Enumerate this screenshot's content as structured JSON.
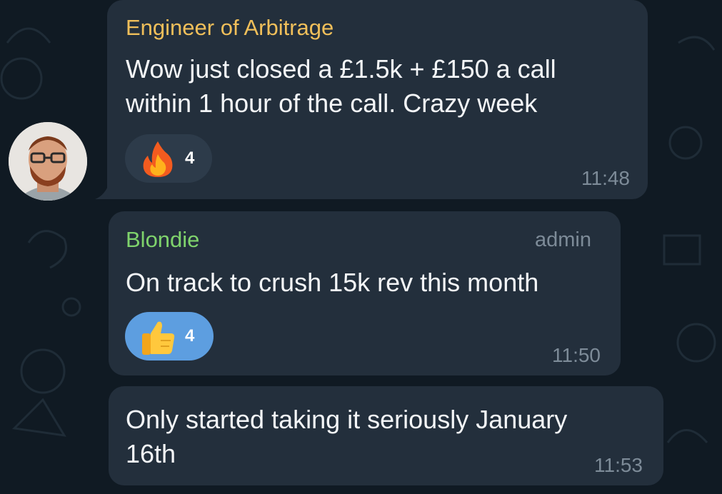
{
  "colors": {
    "background": "#101a23",
    "bubble": "#232f3c",
    "sender_engineer": "#f0bf5a",
    "sender_blondie": "#7fd36c",
    "reaction_default": "#2d3b4a",
    "reaction_selected": "#5d9ee0",
    "meta_text": "#7d8b98"
  },
  "messages": [
    {
      "sender": "Engineer of Arbitrage",
      "lines": [
        "Wow just closed a £1.5k + £150 a call",
        "within 1 hour of the call. Crazy week"
      ],
      "reaction": {
        "emoji": "fire-icon",
        "count": "4"
      },
      "time": "11:48"
    },
    {
      "sender": "Blondie",
      "role": "admin",
      "lines": [
        "On track to crush 15k rev this month"
      ],
      "reaction": {
        "emoji": "thumbs-up-icon",
        "count": "4"
      },
      "time": "11:50"
    },
    {
      "lines": [
        "Only started taking it seriously January",
        "16th"
      ],
      "time": "11:53"
    }
  ]
}
